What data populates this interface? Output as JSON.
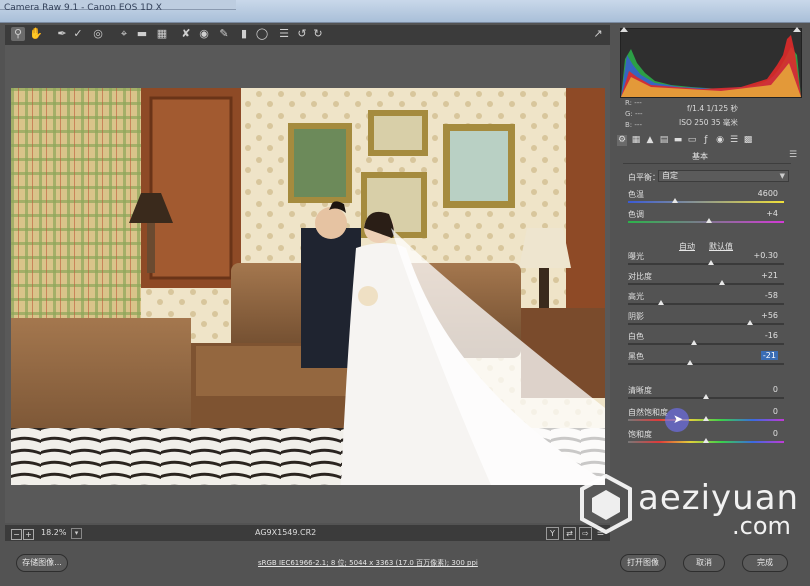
{
  "window": {
    "title": "Camera Raw 9.1 - Canon EOS 1D X"
  },
  "toolbar": {
    "tools": [
      "zoom",
      "hand",
      "white-balance",
      "color-sampler",
      "targeted-adjustment",
      "crop",
      "straighten",
      "transform",
      "spot-removal",
      "red-eye",
      "adjustment-brush",
      "graduated-filter",
      "radial-filter",
      "preferences",
      "rotate-ccw",
      "rotate-cw"
    ]
  },
  "status": {
    "zoom": "18.2%",
    "filename": "AG9X1549.CR2"
  },
  "bottom": {
    "save_label": "存储图像...",
    "workflow_link": "sRGB IEC61966-2.1; 8 位; 5044 x 3363 (17.0 百万像素); 300 ppi",
    "open_label": "打开图像",
    "cancel_label": "取消",
    "done_label": "完成"
  },
  "histogram": {
    "r": "R:  ---",
    "g": "G:  ---",
    "b": "B:  ---"
  },
  "exif": {
    "aperture_shutter": "f/1.4  1/125 秒",
    "iso_focal": "ISO 250  35 毫米"
  },
  "panel": {
    "title": "基本",
    "wb_label": "白平衡：",
    "wb_value": "自定",
    "auto_label": "自动",
    "default_label": "默认值",
    "sliders": [
      {
        "label": "色温",
        "value": "4600",
        "pos": 0.3
      },
      {
        "label": "色调",
        "value": "+4",
        "pos": 0.52
      },
      {
        "label": "曝光",
        "value": "+0.30",
        "pos": 0.53
      },
      {
        "label": "对比度",
        "value": "+21",
        "pos": 0.6
      },
      {
        "label": "高光",
        "value": "-58",
        "pos": 0.21
      },
      {
        "label": "阴影",
        "value": "+56",
        "pos": 0.78
      },
      {
        "label": "白色",
        "value": "-16",
        "pos": 0.42
      },
      {
        "label": "黑色",
        "value": "-21",
        "pos": 0.4,
        "selected": true
      },
      {
        "label": "清晰度",
        "value": "0",
        "pos": 0.5
      },
      {
        "label": "自然饱和度",
        "value": "0",
        "pos": 0.5
      },
      {
        "label": "饱和度",
        "value": "0",
        "pos": 0.5
      }
    ]
  },
  "watermark": {
    "name": "aeziyuan",
    "domain": ".com"
  }
}
